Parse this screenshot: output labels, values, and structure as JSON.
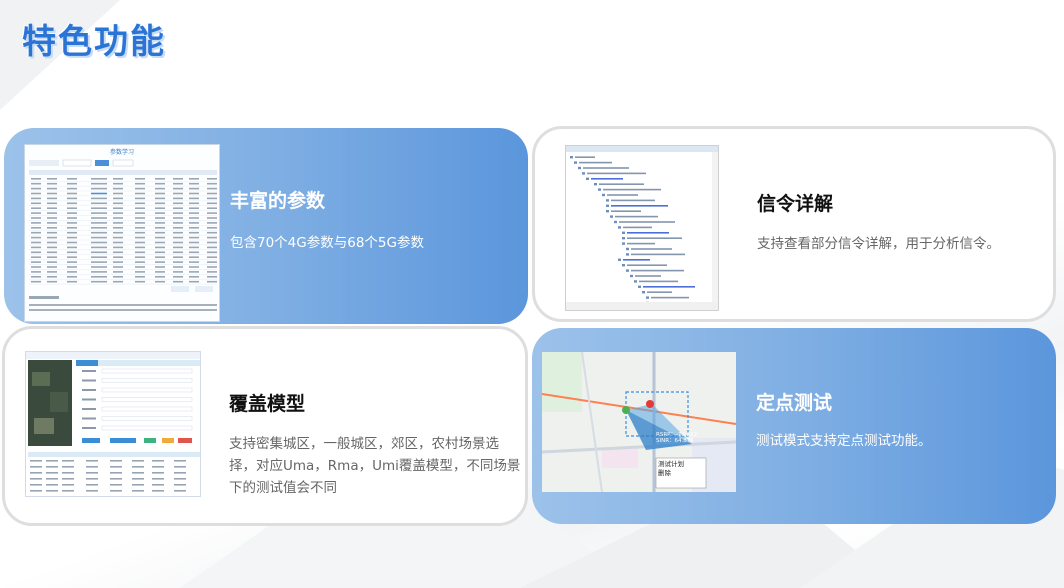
{
  "page": {
    "title": "特色功能"
  },
  "cards": [
    {
      "id": "params",
      "title": "丰富的参数",
      "desc": "包含70个4G参数与68个5G参数",
      "screenshot_title": "参数学习"
    },
    {
      "id": "signaling",
      "title": "信令详解",
      "desc": "支持查看部分信令详解，用于分析信令。"
    },
    {
      "id": "coverage",
      "title": "覆盖模型",
      "desc": "支持密集城区，一般城区，郊区，农村场景选择，对应Uma，Rma，Umi覆盖模型，不同场景下的测试值会不同"
    },
    {
      "id": "fixed-point",
      "title": "定点测试",
      "desc": "测试模式支持定点测试功能。",
      "map_popup": {
        "rsrp": "RSRP：-76.222",
        "sinr": "SINR：64.876",
        "plan": "测试计划",
        "delete": "删除"
      }
    }
  ],
  "colors": {
    "title_blue": "#2a74d6",
    "card_blue_start": "#9cc2ea",
    "card_blue_end": "#5b96dc"
  }
}
